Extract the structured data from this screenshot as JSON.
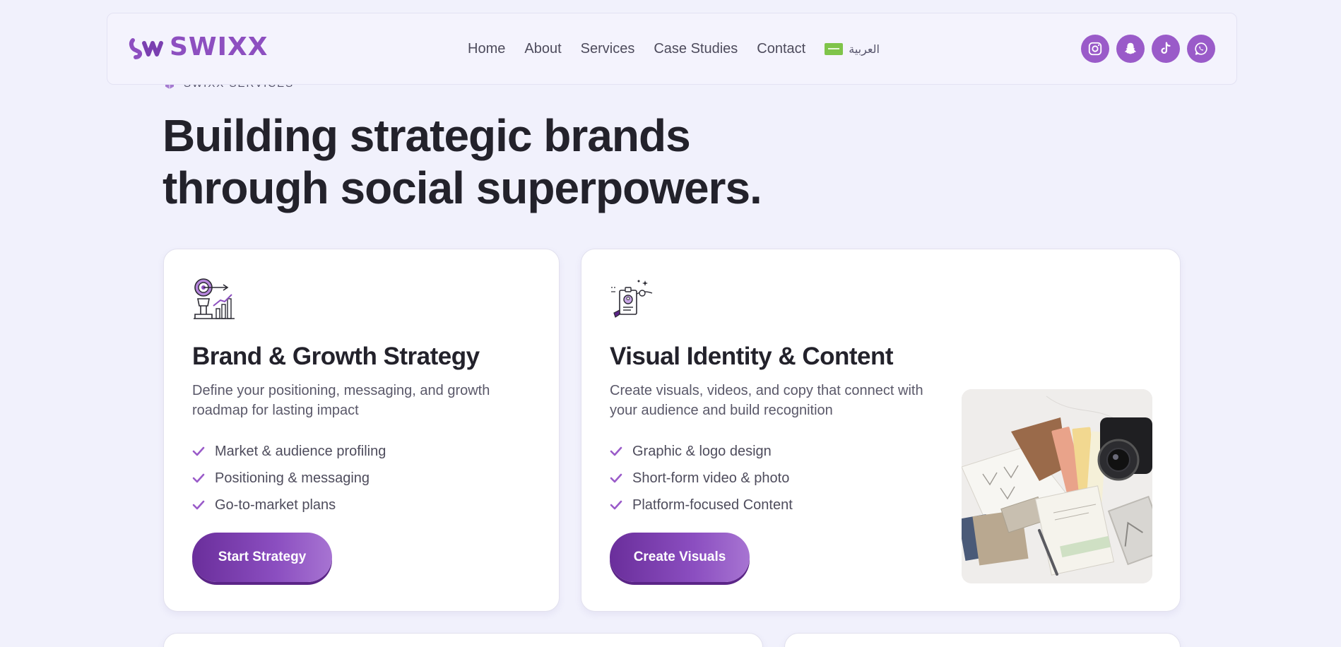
{
  "brand": {
    "name": "SWIXX"
  },
  "nav": {
    "items": [
      {
        "label": "Home"
      },
      {
        "label": "About"
      },
      {
        "label": "Services"
      },
      {
        "label": "Case Studies"
      },
      {
        "label": "Contact"
      }
    ],
    "language_label": "العربية"
  },
  "socials": [
    "instagram-icon",
    "snapchat-icon",
    "tiktok-icon",
    "whatsapp-icon"
  ],
  "hero": {
    "eyebrow": "SWIXX SERVICES",
    "title_line1": "Building strategic brands",
    "title_line2": "through social superpowers."
  },
  "cards": [
    {
      "icon": "target-growth-icon",
      "title": "Brand & Growth Strategy",
      "description": "Define your positioning, messaging, and growth roadmap for lasting impact",
      "features": [
        "Market & audience profiling",
        "Positioning & messaging",
        "Go-to-market plans"
      ],
      "cta": "Start Strategy"
    },
    {
      "icon": "identity-card-icon",
      "title": "Visual Identity & Content",
      "description": "Create visuals, videos, and copy that connect with your audience and build recognition",
      "features": [
        "Graphic & logo design",
        "Short-form video & photo",
        "Platform-focused Content"
      ],
      "cta": "Create Visuals"
    }
  ],
  "colors": {
    "accent": "#8d4fc0",
    "button_start": "#6a2e9b",
    "button_end": "#a774d2",
    "background": "#f1f1fc",
    "heading": "#23222b"
  }
}
